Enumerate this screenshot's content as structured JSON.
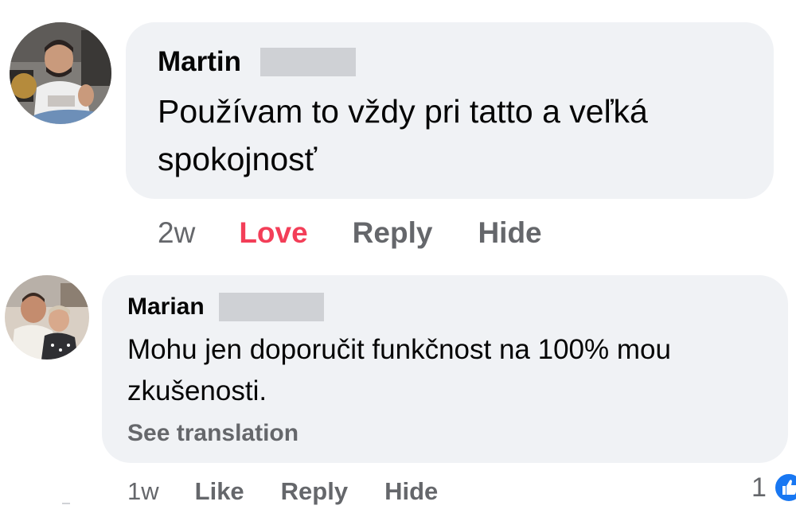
{
  "comments": [
    {
      "author": "Martin",
      "text": "Používam to vždy pri tatto a veľká\nspokojnosť",
      "time": "2w",
      "reaction_label": "Love",
      "reply_label": "Reply",
      "hide_label": "Hide"
    },
    {
      "author": "Marian",
      "text": "Mohu jen doporučit funkčnost na 100% mou\nzkušenosti.",
      "translation_label": "See translation",
      "time": "1w",
      "like_label": "Like",
      "reply_label": "Reply",
      "hide_label": "Hide",
      "reaction_count": "1",
      "reaction_icon": "thumbs-up-icon"
    }
  ],
  "colors": {
    "bubble": "#f0f2f5",
    "love": "#f33e58",
    "meta": "#65676b",
    "like_badge": "#1877f2"
  }
}
